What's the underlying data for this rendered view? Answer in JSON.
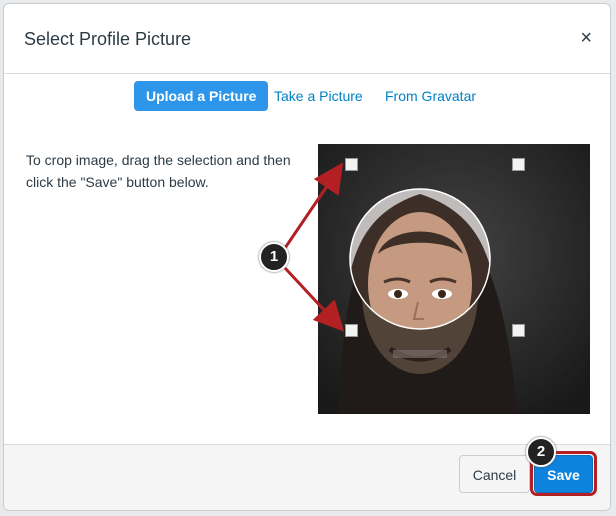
{
  "dialog": {
    "title": "Select Profile Picture",
    "close_glyph": "×"
  },
  "tabs": [
    {
      "label": "Upload a Picture",
      "active": true
    },
    {
      "label": "Take a Picture",
      "active": false
    },
    {
      "label": "From Gravatar",
      "active": false
    }
  ],
  "instructions": "To crop image, drag the selection and then click the \"Save\" button below.",
  "footer": {
    "cancel_label": "Cancel",
    "save_label": "Save"
  },
  "callouts": {
    "one": "1",
    "two": "2"
  },
  "colors": {
    "primary": "#0d83dd",
    "tab_active": "#2d96ea",
    "link": "#0081c5",
    "annotation": "#b22024"
  },
  "icons": [
    "close-icon",
    "crop-handle",
    "callout-badge"
  ]
}
